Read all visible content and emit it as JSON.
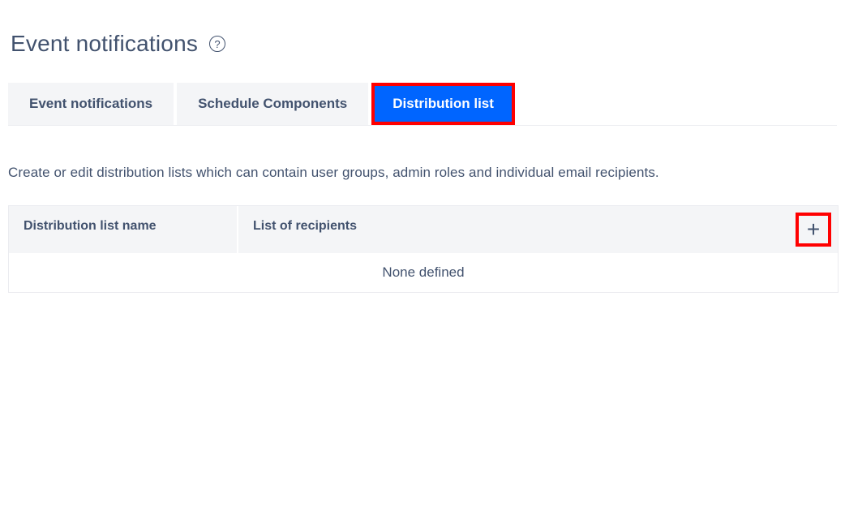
{
  "pageTitle": "Event notifications",
  "tabs": [
    {
      "label": "Event notifications",
      "active": false
    },
    {
      "label": "Schedule Components",
      "active": false
    },
    {
      "label": "Distribution list",
      "active": true
    }
  ],
  "description": "Create or edit distribution lists which can contain user groups, admin roles and individual email recipients.",
  "table": {
    "columns": {
      "name": "Distribution list name",
      "recipients": "List of recipients"
    },
    "empty": "None defined"
  }
}
